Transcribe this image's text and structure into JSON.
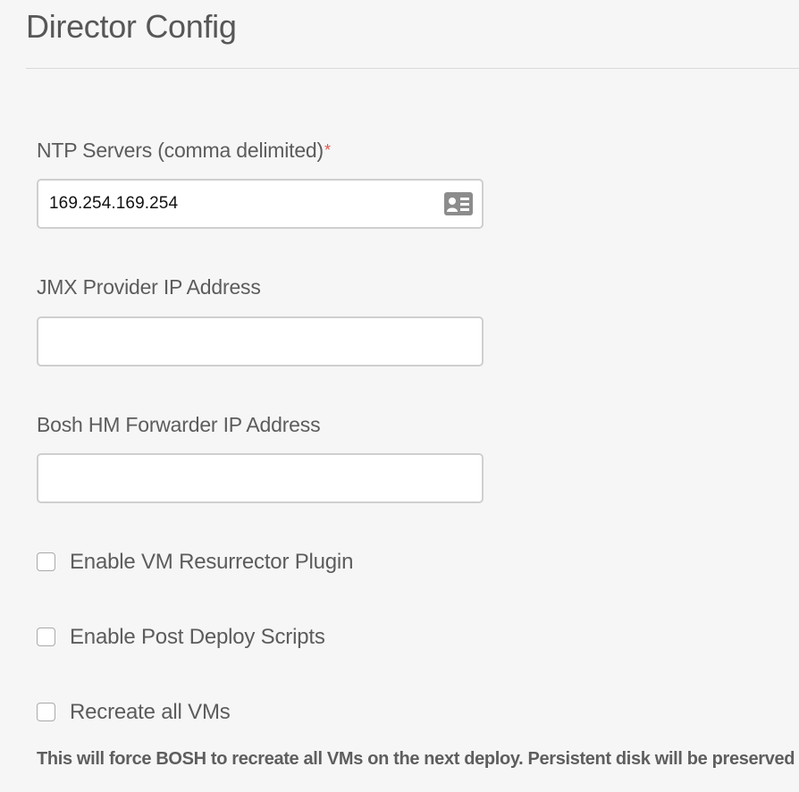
{
  "header": {
    "title": "Director Config"
  },
  "form": {
    "ntp_servers": {
      "label": "NTP Servers (comma delimited)",
      "required_mark": "*",
      "value": "169.254.169.254",
      "icon": "contact-card-icon"
    },
    "jmx_provider": {
      "label": "JMX Provider IP Address",
      "value": ""
    },
    "bosh_hm_forwarder": {
      "label": "Bosh HM Forwarder IP Address",
      "value": ""
    },
    "checkboxes": [
      {
        "label": "Enable VM Resurrector Plugin",
        "checked": false
      },
      {
        "label": "Enable Post Deploy Scripts",
        "checked": false
      },
      {
        "label": "Recreate all VMs",
        "checked": false
      }
    ],
    "recreate_help": "This will force BOSH to recreate all VMs on the next deploy. Persistent disk will be preserved"
  },
  "colors": {
    "background": "#f6f6f6",
    "required": "#e05a4f",
    "input_border": "#cfcfcf"
  }
}
